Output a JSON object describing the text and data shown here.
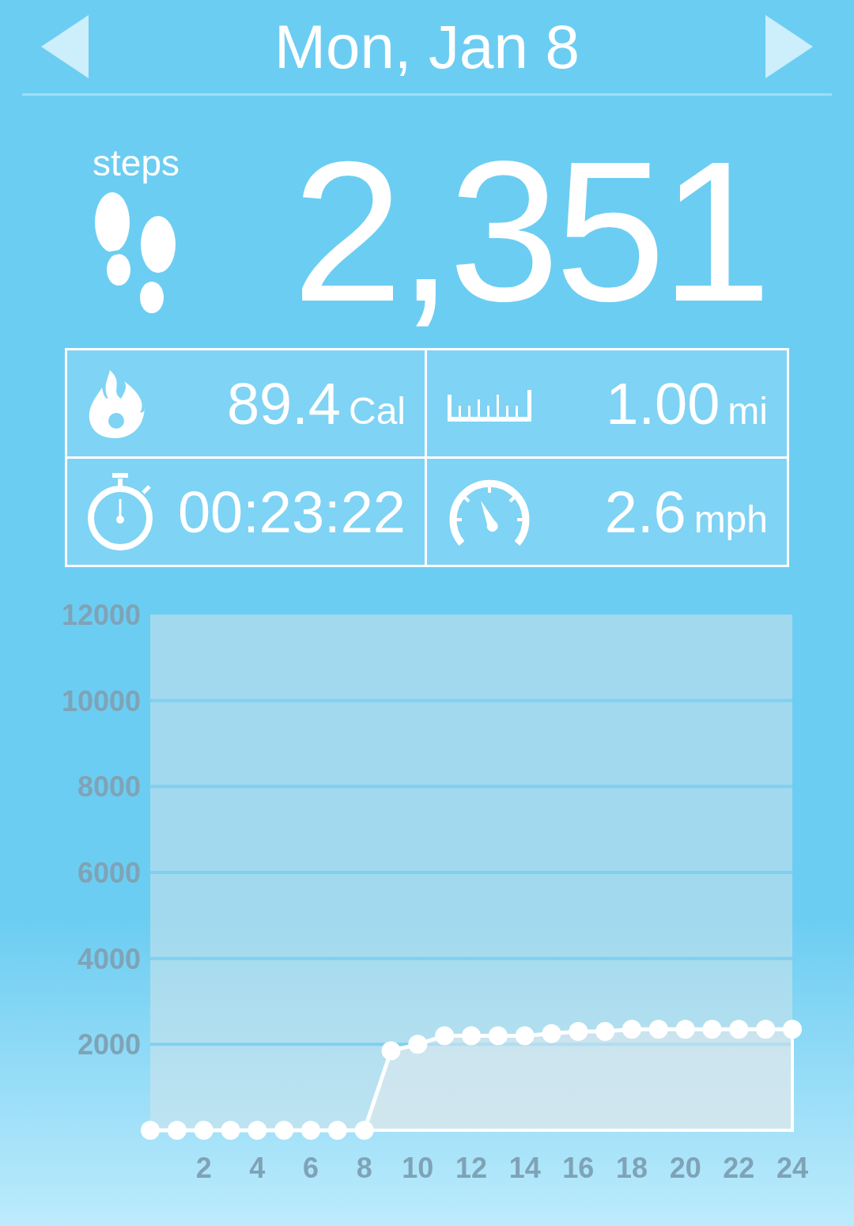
{
  "header": {
    "date": "Mon, Jan 8"
  },
  "steps": {
    "label": "steps",
    "value": "2,351"
  },
  "stats": [
    {
      "kind": "calories",
      "value": "89.4",
      "unit": "Cal"
    },
    {
      "kind": "distance",
      "value": "1.00",
      "unit": "mi"
    },
    {
      "kind": "duration",
      "value": "00:23:22"
    },
    {
      "kind": "speed",
      "value": "2.6",
      "unit": "mph"
    }
  ],
  "chart_data": {
    "type": "area",
    "x": [
      0,
      1,
      2,
      3,
      4,
      5,
      6,
      7,
      8,
      9,
      10,
      11,
      12,
      13,
      14,
      15,
      16,
      17,
      18,
      19,
      20,
      21,
      22,
      23,
      24
    ],
    "series": [
      {
        "color": "#ffffff",
        "values": [
          0,
          0,
          0,
          0,
          0,
          0,
          0,
          0,
          0,
          1850,
          2000,
          2200,
          2200,
          2200,
          2200,
          2250,
          2300,
          2300,
          2350,
          2350,
          2350,
          2350,
          2350,
          2350,
          2350
        ]
      }
    ],
    "grid": true,
    "xlim": [
      0,
      24
    ],
    "ylim": [
      0,
      12000
    ],
    "xticks": [
      2,
      4,
      6,
      8,
      10,
      12,
      14,
      16,
      18,
      20,
      22,
      24
    ],
    "yticks": [
      2000,
      4000,
      6000,
      8000,
      10000,
      12000
    ]
  }
}
